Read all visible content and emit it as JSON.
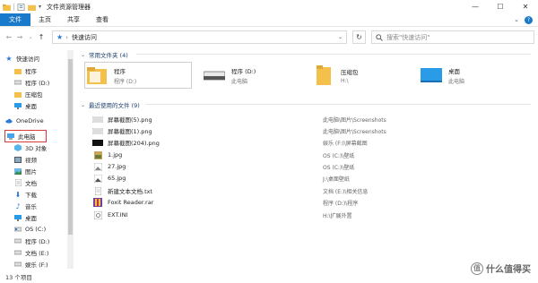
{
  "window": {
    "title": "文件资源管理器",
    "controls": {
      "minimize": "—",
      "maximize": "☐",
      "close": "✕"
    }
  },
  "ribbon": {
    "tabs": [
      "文件",
      "主页",
      "共享",
      "查看"
    ],
    "help": "?"
  },
  "address": {
    "path_label": "快速访问",
    "separator": "›",
    "search_placeholder": "搜索\"快速访问\""
  },
  "sidebar": {
    "items": [
      {
        "label": "快速访问",
        "icon": "star-icon"
      },
      {
        "label": "程序",
        "icon": "folder-icon"
      },
      {
        "label": "程序 (D:)",
        "icon": "drive-icon"
      },
      {
        "label": "压缩包",
        "icon": "folder-icon"
      },
      {
        "label": "桌面",
        "icon": "desktop-icon"
      },
      {
        "label": "OneDrive",
        "icon": "cloud-icon"
      },
      {
        "label": "此电脑",
        "icon": "computer-icon"
      },
      {
        "label": "3D 对象",
        "icon": "cube-icon"
      },
      {
        "label": "视频",
        "icon": "video-icon"
      },
      {
        "label": "图片",
        "icon": "picture-icon"
      },
      {
        "label": "文档",
        "icon": "document-icon"
      },
      {
        "label": "下载",
        "icon": "download-icon"
      },
      {
        "label": "音乐",
        "icon": "music-icon"
      },
      {
        "label": "桌面",
        "icon": "desktop-icon"
      },
      {
        "label": "OS (C:)",
        "icon": "drive-icon"
      },
      {
        "label": "程序 (D:)",
        "icon": "drive-icon"
      },
      {
        "label": "文档 (E:)",
        "icon": "drive-icon"
      },
      {
        "label": "娱乐 (F:)",
        "icon": "drive-icon"
      }
    ]
  },
  "frequent": {
    "header": "常用文件夹 (4)",
    "tiles": [
      {
        "name": "程序",
        "sub": "程序 (D:)",
        "icon": "folder-icon"
      },
      {
        "name": "程序 (D:)",
        "sub": "此电脑",
        "icon": "drive-icon"
      },
      {
        "name": "压缩包",
        "sub": "H:\\",
        "icon": "folder-icon"
      },
      {
        "name": "桌面",
        "sub": "此电脑",
        "icon": "desktop-icon"
      }
    ]
  },
  "recent": {
    "header": "最近使用的文件 (9)",
    "files": [
      {
        "name": "屏幕截图(5).png",
        "location": "此电脑\\图片\\Screenshots",
        "icon": "image-file-icon"
      },
      {
        "name": "屏幕截图(1).png",
        "location": "此电脑\\图片\\Screenshots",
        "icon": "image-file-icon"
      },
      {
        "name": "屏幕截图(204).png",
        "location": "娱乐 (F:)\\屏幕截图",
        "icon": "image-file-icon"
      },
      {
        "name": "1.jpg",
        "location": "OS (C:)\\壁纸",
        "icon": "image-file-icon"
      },
      {
        "name": "27.jpg",
        "location": "OS (C:)\\壁纸",
        "icon": "image-file-icon"
      },
      {
        "name": "65.jpg",
        "location": "J:\\桌面壁纸",
        "icon": "image-file-icon"
      },
      {
        "name": "新建文本文档.txt",
        "location": "文档 (E:)\\相关信息",
        "icon": "text-file-icon"
      },
      {
        "name": "Foxit Reader.rar",
        "location": "程序 (D:)\\程序",
        "icon": "archive-file-icon"
      },
      {
        "name": "EXT.INI",
        "location": "H:\\扩展外置",
        "icon": "ini-file-icon"
      }
    ]
  },
  "status": {
    "count": "13 个项目"
  },
  "watermark": {
    "text": "什么值得买",
    "logo": "值"
  },
  "colors": {
    "accent": "#1979ca",
    "highlight_box": "#d63c3c",
    "folder": "#f3c14b"
  }
}
